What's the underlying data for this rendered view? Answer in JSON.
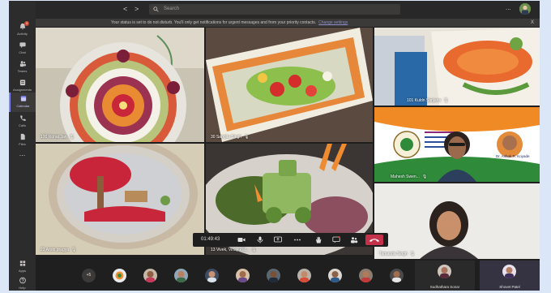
{
  "rail": {
    "items": [
      {
        "label": "Activity",
        "badge": "3"
      },
      {
        "label": "Chat"
      },
      {
        "label": "Teams"
      },
      {
        "label": "Assignments"
      },
      {
        "label": "Calendar"
      },
      {
        "label": "Calls"
      },
      {
        "label": "Files"
      },
      {
        "label": "..."
      }
    ],
    "bottom": [
      {
        "label": "Apps"
      },
      {
        "label": "Help"
      }
    ]
  },
  "topbar": {
    "back": "<",
    "forward": ">",
    "search_placeholder": "Search",
    "more": "..."
  },
  "notice": {
    "text": "Your status is set to do not disturb. You'll only get notifications for urgent messages and from your priority contacts.",
    "link": "Change settings",
    "close": "X"
  },
  "tiles": [
    {
      "name": "100 Rohat Jan"
    },
    {
      "name": "30 Sangita Singh"
    },
    {
      "name": "101 Kuldn Sanjane"
    },
    {
      "name": "22 Arohi pragya"
    },
    {
      "name": "13 Vivek, Vinay Pal..."
    },
    {
      "name": "Mahesh Swen..."
    },
    {
      "name": "Tamanda Singh"
    }
  ],
  "presenter_card": {
    "name": "Dr. Ashok R. Koyade"
  },
  "controls": {
    "timer": "01:49:43"
  },
  "strip": {
    "overflow": "+5",
    "cards": [
      {
        "name": "Sudhathara Sonar"
      },
      {
        "name": "Shovet Patel"
      }
    ]
  },
  "colors": {
    "app_bg": "#1f1f1f",
    "rail_bg": "#2d2c2c",
    "accent": "#7f85f5",
    "hangup": "#c4314b",
    "page_bg": "#dbe7f6"
  }
}
